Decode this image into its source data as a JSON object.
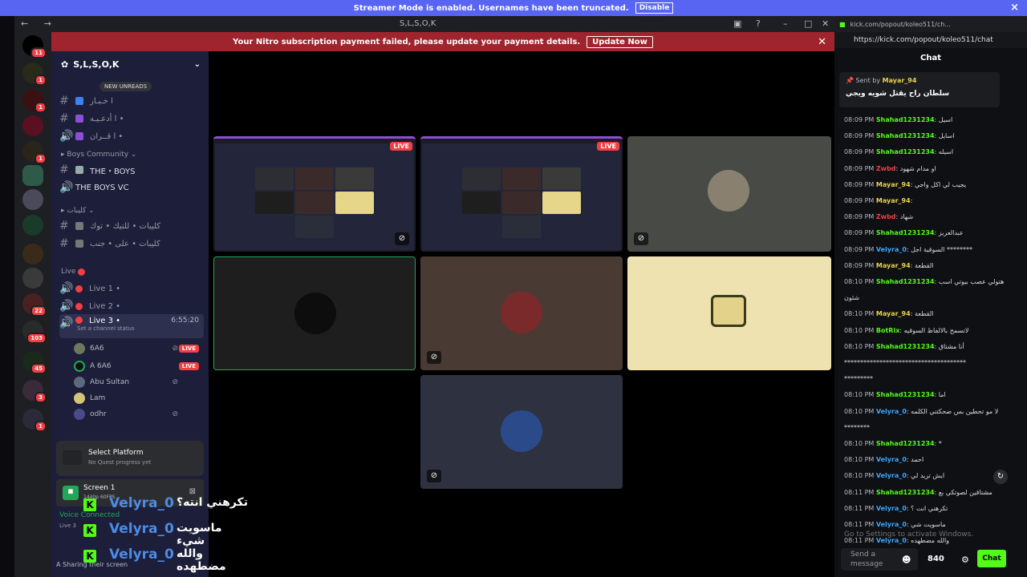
{
  "streamer_bar": {
    "text": "Streamer Mode is enabled. Usernames have been truncated.",
    "button": "Disable"
  },
  "discord": {
    "title": "S,L,S,O,K",
    "nitro_banner": {
      "text": "Your Nitro subscription payment failed, please update your payment details.",
      "button": "Update Now"
    },
    "server_name": "S,L,S,O,K",
    "new_unreads": "NEW UNREADS",
    "server_badges": [
      "11",
      "1",
      "1",
      "1",
      "22",
      "103",
      "45",
      "3",
      "1"
    ],
    "channels": [
      {
        "name": "ا خـبـار"
      },
      {
        "name": "ا أدعـيـه •"
      },
      {
        "name": "ا قــران •"
      }
    ],
    "category_boys": "Boys Community",
    "boys_channels": [
      {
        "name": "THE・BOYS"
      },
      {
        "name": "THE BOYS VC"
      }
    ],
    "category_kalibat": "كليبات",
    "kalibat_channels": [
      {
        "name": "كليبات • للتيك • توك"
      },
      {
        "name": "كليبات • على • جنب"
      }
    ],
    "category_live": "Live",
    "live_channels": [
      {
        "name": "Live 1 •"
      },
      {
        "name": "Live 2 •"
      },
      {
        "name": "Live 3 •"
      }
    ],
    "live3_timer": "6:55:20",
    "set_status": "Set a channel status",
    "members": [
      {
        "name": "6A6",
        "live": "LIVE"
      },
      {
        "name": "A 6A6",
        "live": "LIVE"
      },
      {
        "name": "Abu Sultan"
      },
      {
        "name": "Lam"
      },
      {
        "name": "odhr"
      }
    ],
    "quest": {
      "title": "Select Platform",
      "subtitle": "No Quest progress yet"
    },
    "screen_share": {
      "title": "Screen 1",
      "subtitle": "1440p 60FPS"
    },
    "voice": {
      "status": "Voice Connected",
      "channel": "Live 3"
    },
    "user": {
      "name": "A",
      "status": "Sharing their screen"
    },
    "tile_live_label": "LIVE"
  },
  "overlay_chat": [
    {
      "user": "Velyra_0",
      "msg": "تكرهني انته؟"
    },
    {
      "user": "Velyra_0",
      "msg": "ماسويت شيء"
    },
    {
      "user": "Velyra_0",
      "msg": "والله مضطهده"
    }
  ],
  "kick": {
    "tab_title": "kick.com/popout/koleo511/ch...",
    "url": "https://kick.com/popout/koleo511/chat",
    "chat_header": "Chat",
    "pinned": {
      "sent_by": "Sent by",
      "user": "Mayar_94",
      "msg": "سلطان راح يقتل شويه ويجي"
    },
    "messages": [
      {
        "time": "08:09 PM",
        "user": "Shahad1231234",
        "color": "green",
        "text": "اسيل"
      },
      {
        "time": "08:09 PM",
        "user": "Shahad1231234",
        "color": "green",
        "text": "اسايل"
      },
      {
        "time": "08:09 PM",
        "user": "Shahad1231234",
        "color": "green",
        "text": "اسيله"
      },
      {
        "time": "08:09 PM",
        "user": "Zwbd",
        "color": "red",
        "text": "او مدام شهود"
      },
      {
        "time": "08:09 PM",
        "user": "Mayar_94",
        "color": "yellow",
        "text": "يجيب لي اكل واجي"
      },
      {
        "time": "08:09 PM",
        "user": "Mayar_94",
        "color": "yellow",
        "text": ""
      },
      {
        "time": "08:09 PM",
        "user": "Zwbd",
        "color": "red",
        "text": "شهاد"
      },
      {
        "time": "08:09 PM",
        "user": "Shahad1231234",
        "color": "green",
        "text": "عبدالعزيز"
      },
      {
        "time": "08:09 PM",
        "user": "Velyra_0",
        "color": "blue",
        "text": "السوقية اجل ********"
      },
      {
        "time": "08:09 PM",
        "user": "Mayar_94",
        "color": "yellow",
        "text": "القطعة"
      },
      {
        "time": "08:10 PM",
        "user": "Shahad1231234",
        "color": "green",
        "text": "هتولي عصب بيوتي اسب"
      },
      {
        "time": "",
        "user": "",
        "color": "green",
        "text": "شئون"
      },
      {
        "time": "08:10 PM",
        "user": "Mayar_94",
        "color": "yellow",
        "text": "القطعة"
      },
      {
        "time": "08:10 PM",
        "user": "BotRix",
        "color": "green",
        "text": "لاتسمح بالالفاظ السوقيه"
      },
      {
        "time": "08:10 PM",
        "user": "Shahad1231234",
        "color": "green",
        "text": "أنا مشتاق"
      },
      {
        "time": "",
        "user": "",
        "color": "green",
        "text": "**************************************"
      },
      {
        "time": "",
        "user": "",
        "color": "green",
        "text": "*********"
      },
      {
        "time": "08:10 PM",
        "user": "Shahad1231234",
        "color": "green",
        "text": "اما"
      },
      {
        "time": "08:10 PM",
        "user": "Velyra_0",
        "color": "blue",
        "text": "لا مو تحطين بس ضحكتني الكلمه"
      },
      {
        "time": "",
        "user": "",
        "color": "green",
        "text": "********"
      },
      {
        "time": "08:10 PM",
        "user": "Shahad1231234",
        "color": "green",
        "text": "*"
      },
      {
        "time": "08:10 PM",
        "user": "Velyra_0",
        "color": "blue",
        "text": "احمد"
      },
      {
        "time": "08:10 PM",
        "user": "Velyra_0",
        "color": "blue",
        "text": "ايش تريد لي"
      },
      {
        "time": "08:11 PM",
        "user": "Shahad1231234",
        "color": "green",
        "text": "مشتاقين لصوتكي بع"
      },
      {
        "time": "08:11 PM",
        "user": "Velyra_0",
        "color": "blue",
        "text": "تكرهني انت ؟"
      },
      {
        "time": "08:11 PM",
        "user": "Velyra_0",
        "color": "blue",
        "text": "ماسويت شي"
      },
      {
        "time": "08:11 PM",
        "user": "Velyra_0",
        "color": "blue",
        "text": "والله مضطهده"
      }
    ],
    "windows_watermark": "Go to Settings to activate Windows.",
    "input_placeholder": "Send a message",
    "points": "840",
    "send": "Chat"
  }
}
